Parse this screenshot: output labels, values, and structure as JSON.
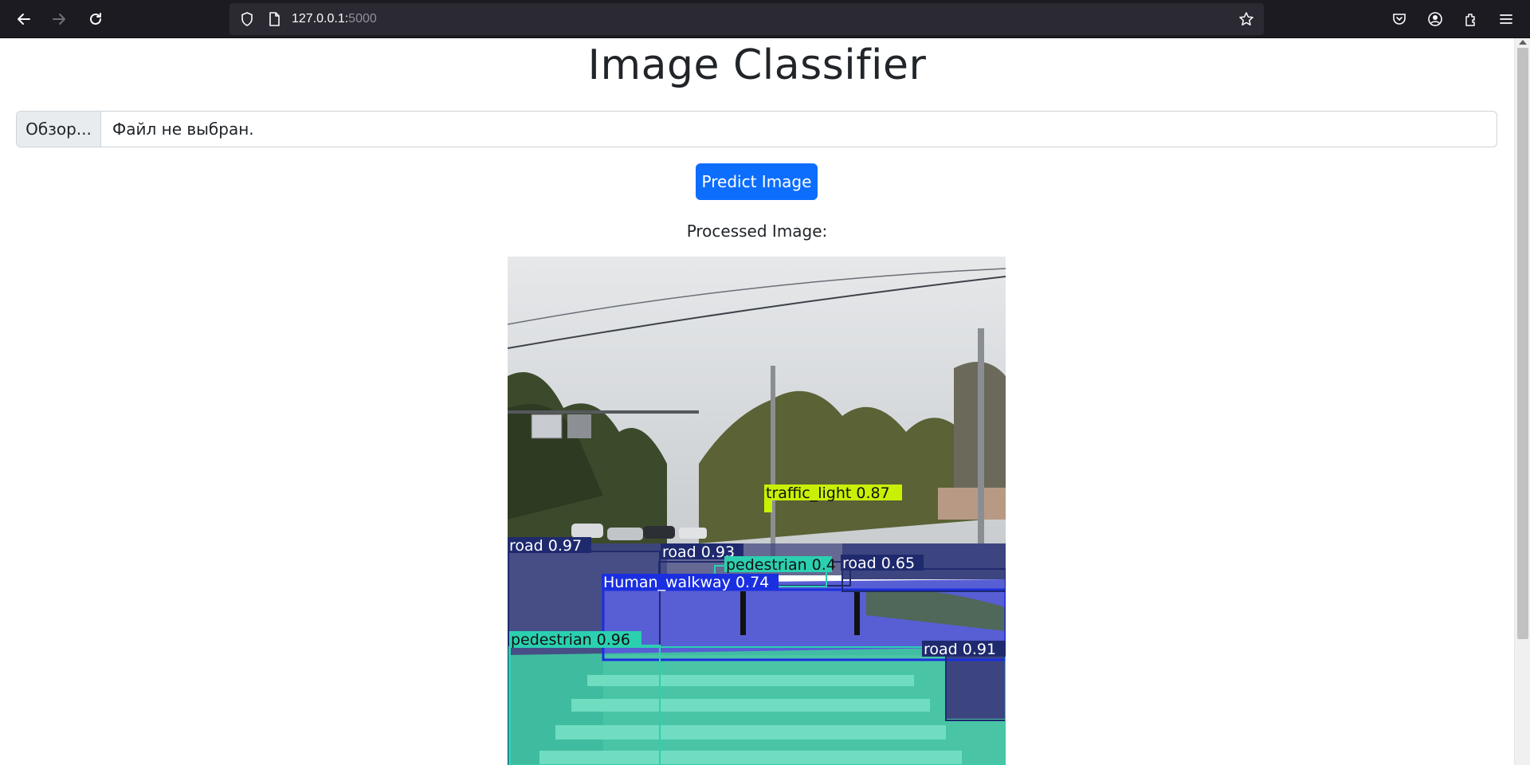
{
  "browser": {
    "url_host": "127.0.0.1:",
    "url_port": "5000",
    "icons": [
      "back-arrow-icon",
      "forward-arrow-icon",
      "reload-icon",
      "shield-icon",
      "page-icon",
      "star-icon",
      "pocket-icon",
      "account-icon",
      "extensions-icon",
      "menu-icon"
    ]
  },
  "page": {
    "title": "Image Classifier",
    "file_button_label": "Обзор...",
    "file_status": "Файл не выбран.",
    "predict_button_label": "Predict Image",
    "processed_label": "Processed Image:"
  },
  "detections": [
    {
      "label": "traffic_light 0.87",
      "color": "#c8f005"
    },
    {
      "label": "road 0.97",
      "color": "#1f2a6e"
    },
    {
      "label": "road 0.93",
      "color": "#1f2a6e"
    },
    {
      "label": "pedestrian 0.4",
      "color": "#2bd0b0"
    },
    {
      "label": "road 0.65",
      "color": "#1f2a6e"
    },
    {
      "label": "Human_walkway 0.74",
      "color": "#1a2fe0"
    },
    {
      "label": "pedestrian 0.96",
      "color": "#2bd0b0"
    },
    {
      "label": "road 0.91",
      "color": "#1f2a6e"
    }
  ],
  "colors": {
    "chrome_bg": "#1c1b22",
    "urlbar_bg": "#2b2a33",
    "primary": "#0d6efd"
  }
}
